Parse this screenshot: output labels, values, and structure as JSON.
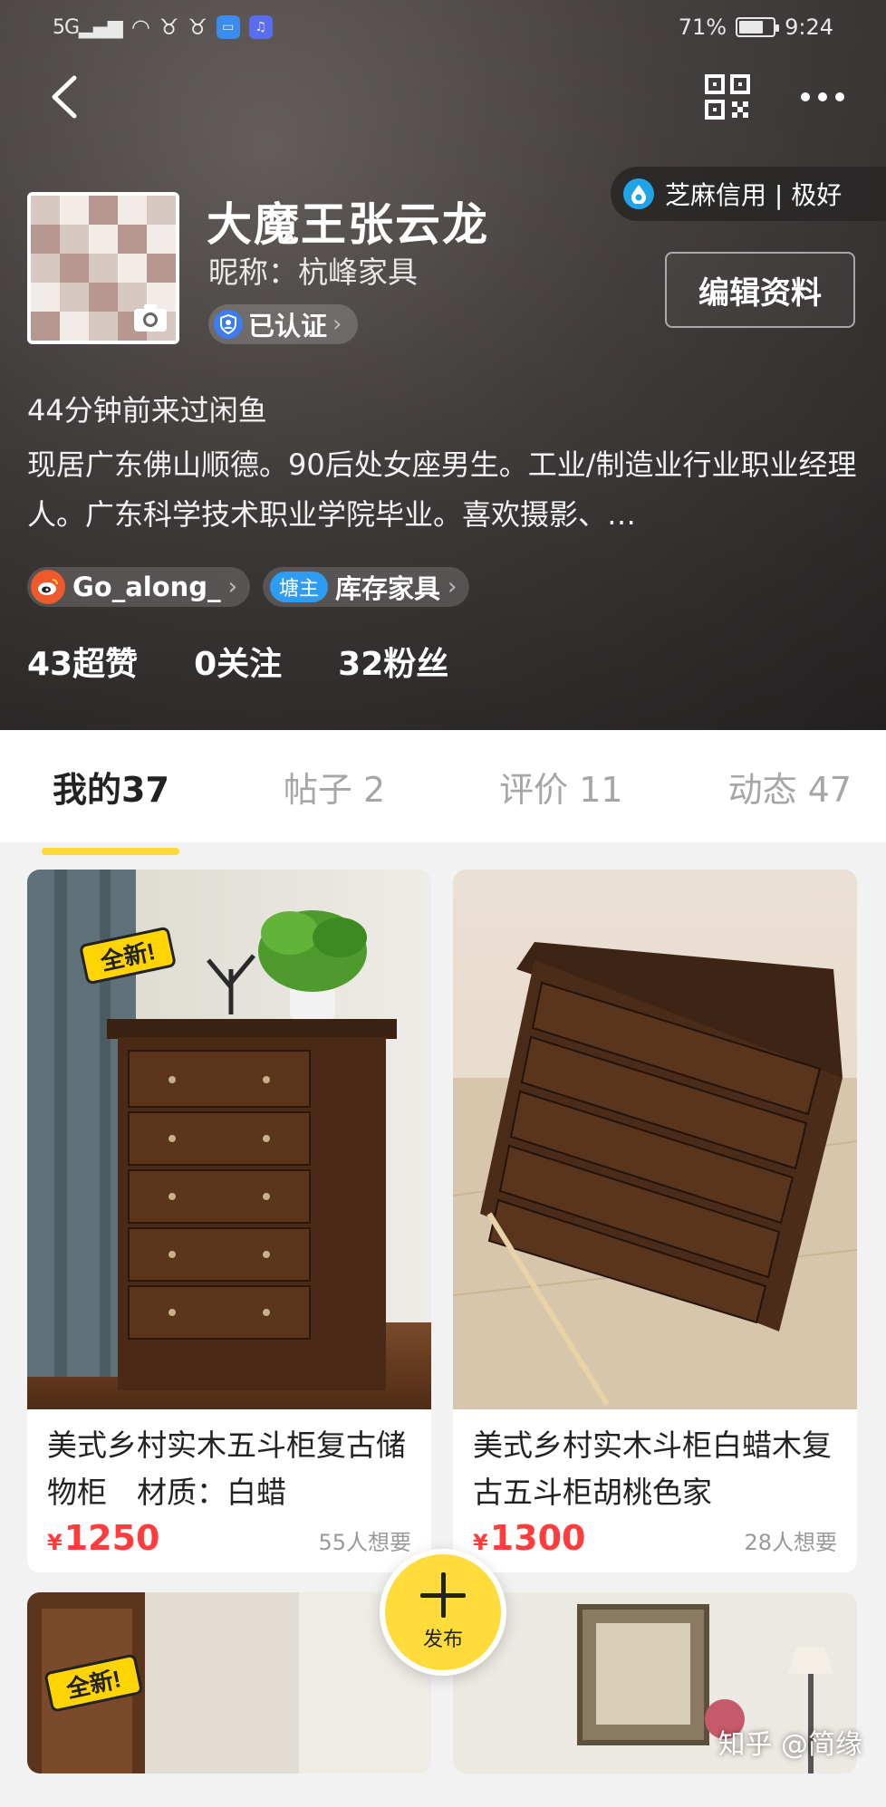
{
  "status_bar": {
    "network": "5G",
    "battery": "71%",
    "battery_level": 0.71,
    "time": "9:24"
  },
  "credit": {
    "label": "芝麻信用 | 极好"
  },
  "profile": {
    "name": "大魔王张云龙",
    "nickname": "昵称：杭峰家具",
    "verified": "已认证",
    "edit_button": "编辑资料",
    "last_visit": "44分钟前来过闲鱼",
    "bio": "现居广东佛山顺德。90后处女座男生。工业/制造业行业职业经理人。广东科学技术职业学院毕业。喜欢摄影、…",
    "weibo_handle": "Go_along_",
    "pond_tag": "塘主",
    "pond_name": "库存家具",
    "stats": [
      "43超赞",
      "0关注",
      "32粉丝"
    ]
  },
  "tabs": [
    {
      "label": "我的37",
      "active": true
    },
    {
      "label": "帖子 2",
      "active": false
    },
    {
      "label": "评价 11",
      "active": false
    },
    {
      "label": "动态 47",
      "active": false
    }
  ],
  "items": [
    {
      "title": "美式乡村实木五斗柜复古储物柜　材质：白蜡",
      "currency": "¥",
      "price": "1250",
      "wants": "55人想要",
      "badge": "全新!"
    },
    {
      "title": "美式乡村实木斗柜白蜡木复古五斗柜胡桃色家",
      "currency": "¥",
      "price": "1300",
      "wants": "28人想要"
    }
  ],
  "fab": {
    "label": "发布"
  },
  "watermark": "知乎 @简缘",
  "colors": {
    "accent": "#ffd83a",
    "price": "#ff3d3d",
    "credit_blue": "#1fa4e8"
  }
}
